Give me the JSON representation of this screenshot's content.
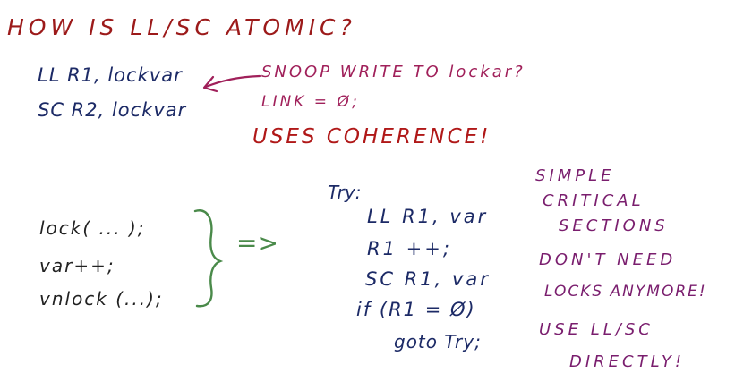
{
  "colors": {
    "title": "#9c1a1a",
    "code": "#1c2a66",
    "note": "#a0205a",
    "dark": "#222222",
    "brace": "#4a8a4a",
    "side_note": "#7a1e6e"
  },
  "title": "HOW IS LL/SC ATOMIC?",
  "top_code": {
    "line1": "LL R1, lockvar",
    "line2": "SC R2, lockvar"
  },
  "notes": {
    "snoop": "SNOOP WRITE TO lockar?",
    "link": "LINK = Ø;",
    "coherence": "USES COHERENCE!"
  },
  "left_code": {
    "line1": "lock( ... );",
    "line2": "var++;",
    "line3": "vnlock (...);"
  },
  "implies": "=>",
  "try_code": {
    "label": "Try:",
    "line1": "LL R1, var",
    "line2": "R1 ++;",
    "line3": "SC R1, var",
    "line4": "if (R1 = Ø)",
    "line5": "goto Try;"
  },
  "side_notes": {
    "line1": "SIMPLE",
    "line2": "CRITICAL",
    "line3": "SECTIONS",
    "line4": "DON'T NEED",
    "line5": "LOCKS ANYMORE!",
    "line6": "USE LL/SC",
    "line7": "DIRECTLY!"
  }
}
